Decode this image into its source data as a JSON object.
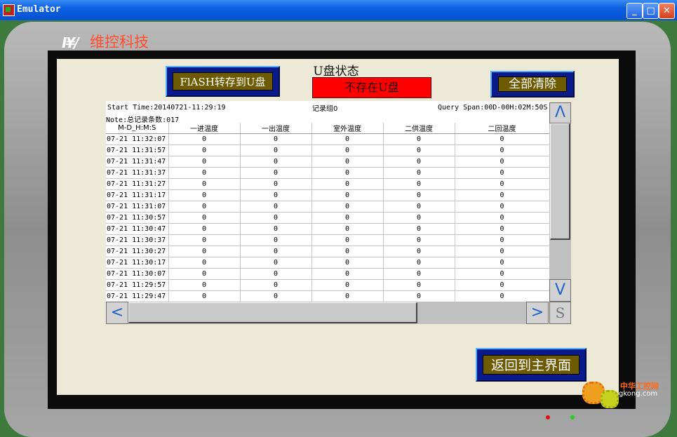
{
  "window": {
    "title": "Emulator",
    "minimize": "_",
    "maximize": "□",
    "close": "✕"
  },
  "brand": {
    "logo": "I¥/",
    "name": "维控科技"
  },
  "buttons": {
    "flash_to_usb": "FlASH转存到U盘",
    "clear_all": "全部清除",
    "back_home": "返回到主界面"
  },
  "usb": {
    "title": "U盘状态",
    "status": "不存在U盘",
    "status_color": "#ff0000"
  },
  "log": {
    "start_time": "Start Time:20140721-11:29:19",
    "group": "记录组0",
    "query_span": "Query Span:00D-00H:02M:50S",
    "note": "Note:总记录条数:017",
    "columns": [
      "M-D_H:M:S",
      "一进温度",
      "一出温度",
      "室外温度",
      "二供温度",
      "二回温度"
    ],
    "rows": [
      [
        "07-21 11:32:07",
        "0",
        "0",
        "0",
        "0",
        "0"
      ],
      [
        "07-21 11:31:57",
        "0",
        "0",
        "0",
        "0",
        "0"
      ],
      [
        "07-21 11:31:47",
        "0",
        "0",
        "0",
        "0",
        "0"
      ],
      [
        "07-21 11:31:37",
        "0",
        "0",
        "0",
        "0",
        "0"
      ],
      [
        "07-21 11:31:27",
        "0",
        "0",
        "0",
        "0",
        "0"
      ],
      [
        "07-21 11:31:17",
        "0",
        "0",
        "0",
        "0",
        "0"
      ],
      [
        "07-21 11:31:07",
        "0",
        "0",
        "0",
        "0",
        "0"
      ],
      [
        "07-21 11:30:57",
        "0",
        "0",
        "0",
        "0",
        "0"
      ],
      [
        "07-21 11:30:47",
        "0",
        "0",
        "0",
        "0",
        "0"
      ],
      [
        "07-21 11:30:37",
        "0",
        "0",
        "0",
        "0",
        "0"
      ],
      [
        "07-21 11:30:27",
        "0",
        "0",
        "0",
        "0",
        "0"
      ],
      [
        "07-21 11:30:17",
        "0",
        "0",
        "0",
        "0",
        "0"
      ],
      [
        "07-21 11:30:07",
        "0",
        "0",
        "0",
        "0",
        "0"
      ],
      [
        "07-21 11:29:57",
        "0",
        "0",
        "0",
        "0",
        "0"
      ],
      [
        "07-21 11:29:47",
        "0",
        "0",
        "0",
        "0",
        "0"
      ]
    ]
  },
  "scroll": {
    "up": "Λ",
    "down": "V",
    "left": "<",
    "right": ">",
    "grip": "S"
  },
  "watermark": {
    "line1": "中华工控网",
    "line2": "gkong.com"
  },
  "colors": {
    "led_red": "#e01010",
    "led_green": "#20d020",
    "accent": "#0a1a8a"
  },
  "icons": {
    "app": "emulator-app-icon",
    "logo": "weikong-logo-icon"
  }
}
